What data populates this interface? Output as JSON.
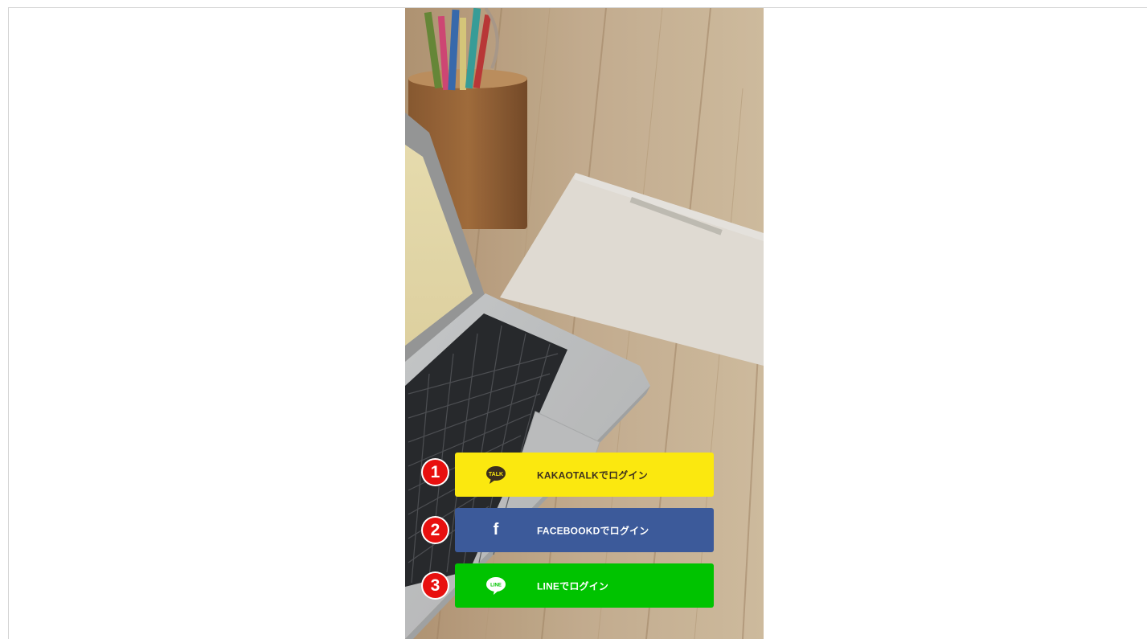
{
  "login": {
    "buttons": [
      {
        "label": "KAKAOTALKでログイン",
        "icon": "kakaotalk-icon",
        "icon_text": "TALK",
        "marker": "1"
      },
      {
        "label": "FACEBOOKDでログイン",
        "icon": "facebook-icon",
        "icon_text": "f",
        "marker": "2"
      },
      {
        "label": "LINEでログイン",
        "icon": "line-icon",
        "icon_text": "LINE",
        "marker": "3"
      }
    ]
  },
  "colors": {
    "kakao": "#fbe80f",
    "facebook": "#3c5a9a",
    "line": "#00c300",
    "marker": "#e8100f"
  }
}
